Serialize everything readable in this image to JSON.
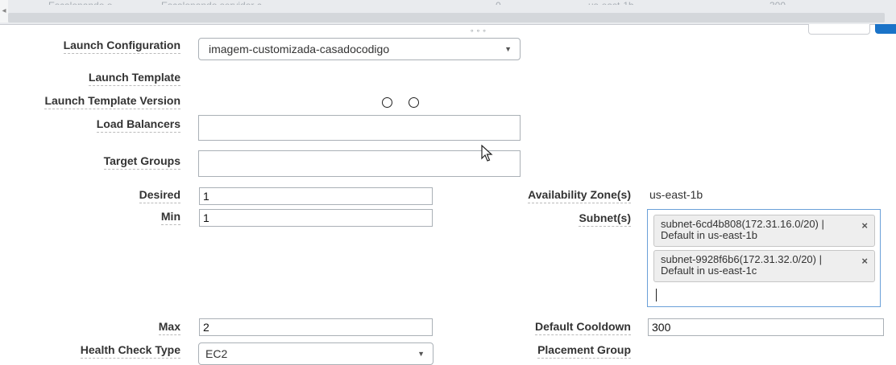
{
  "top_ghost": [
    "Escalonando o...",
    "Escalonando servidor c...",
    "0",
    "us-east-1b",
    "300"
  ],
  "form": {
    "launch_configuration_label": "Launch Configuration",
    "launch_configuration_value": "imagem-customizada-casadocodigo",
    "launch_template_label": "Launch Template",
    "launch_template_version_label": "Launch Template Version",
    "load_balancers_label": "Load Balancers",
    "target_groups_label": "Target Groups",
    "desired_label": "Desired",
    "desired_value": "1",
    "min_label": "Min",
    "min_value": "1",
    "max_label": "Max",
    "max_value": "2",
    "health_check_type_label": "Health Check Type",
    "health_check_type_value": "EC2",
    "availability_zones_label": "Availability Zone(s)",
    "availability_zones_value": "us-east-1b",
    "subnets_label": "Subnet(s)",
    "subnets": [
      {
        "line1": "subnet-6cd4b808(172.31.16.0/20) |",
        "line2": "Default in us-east-1b"
      },
      {
        "line1": "subnet-9928f6b6(172.31.32.0/20) |",
        "line2": "Default in us-east-1c"
      }
    ],
    "remove_glyph": "×",
    "default_cooldown_label": "Default Cooldown",
    "default_cooldown_value": "300",
    "placement_group_label": "Placement Group"
  },
  "icons": [
    "caret-down-icon",
    "remove-icon",
    "mouse-cursor-icon",
    "radio-icon"
  ]
}
